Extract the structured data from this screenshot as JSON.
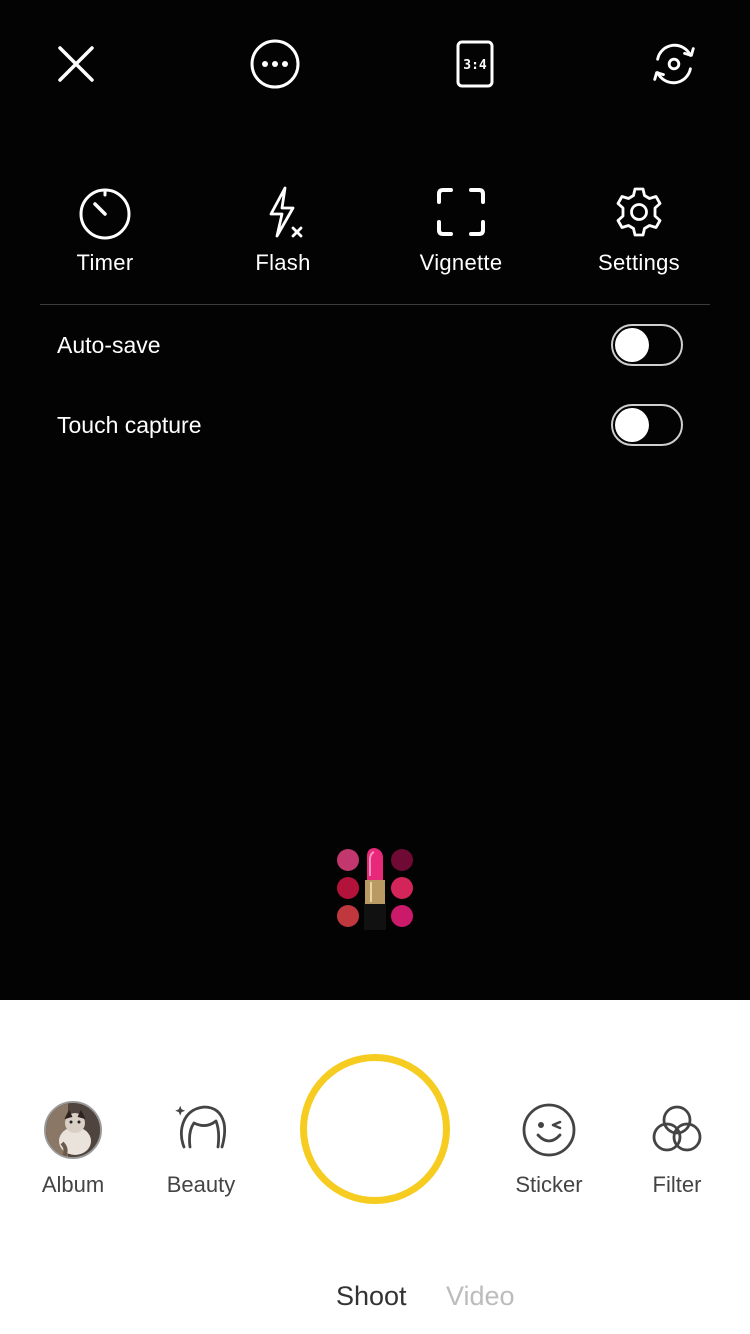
{
  "top_bar": {
    "close_icon": "close-icon",
    "more_icon": "more-icon",
    "aspect_ratio": "3:4",
    "switch_camera_icon": "switch-camera-icon"
  },
  "quick_settings": [
    {
      "label": "Timer",
      "icon": "timer-icon"
    },
    {
      "label": "Flash",
      "icon": "flash-off-icon"
    },
    {
      "label": "Vignette",
      "icon": "vignette-icon"
    },
    {
      "label": "Settings",
      "icon": "gear-icon"
    }
  ],
  "toggles": [
    {
      "label": "Auto-save",
      "on": false
    },
    {
      "label": "Touch capture",
      "on": false
    }
  ],
  "beauty_badge_icon": "lipstick-palette-icon",
  "bottom_tools": {
    "left": [
      {
        "label": "Album",
        "icon": "album-thumbnail"
      },
      {
        "label": "Beauty",
        "icon": "beauty-face-icon"
      }
    ],
    "right": [
      {
        "label": "Sticker",
        "icon": "sticker-icon"
      },
      {
        "label": "Filter",
        "icon": "filter-icon"
      }
    ]
  },
  "modes": [
    {
      "label": "Shoot",
      "active": true
    },
    {
      "label": "Video",
      "active": false
    }
  ],
  "colors": {
    "accent": "#F5CC1F",
    "viewfinder": "#030304",
    "panel": "#FFFFFF"
  }
}
